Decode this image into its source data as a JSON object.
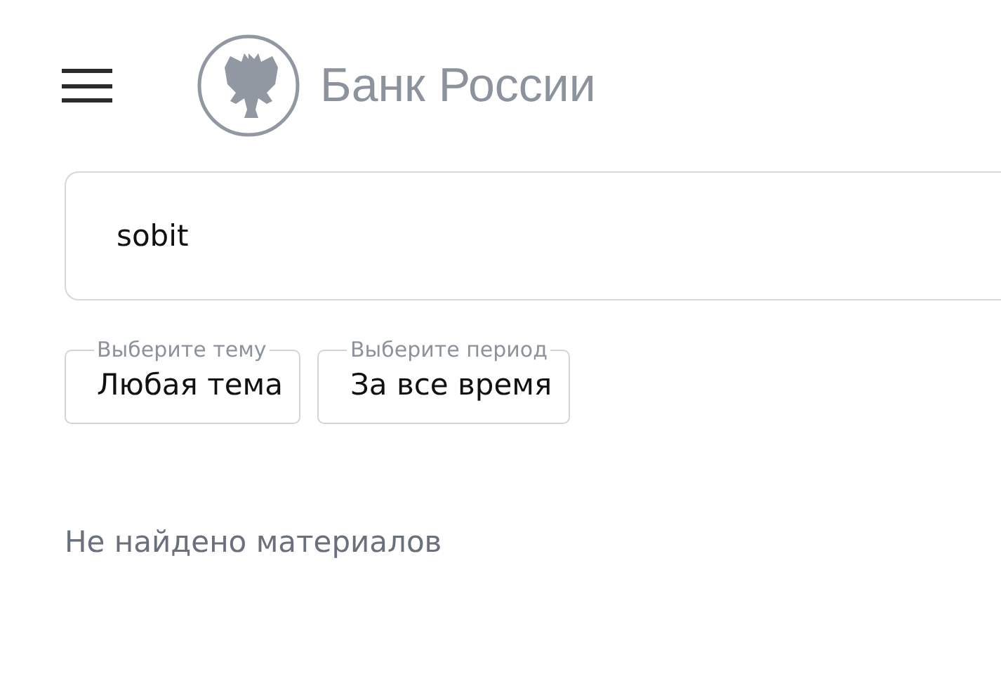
{
  "header": {
    "logo_text": "Банк России"
  },
  "search": {
    "value": "sobit"
  },
  "filters": [
    {
      "label": "Выберите тему",
      "value": "Любая тема"
    },
    {
      "label": "Выберите период",
      "value": "За все время"
    }
  ],
  "message": "Не найдено материалов"
}
